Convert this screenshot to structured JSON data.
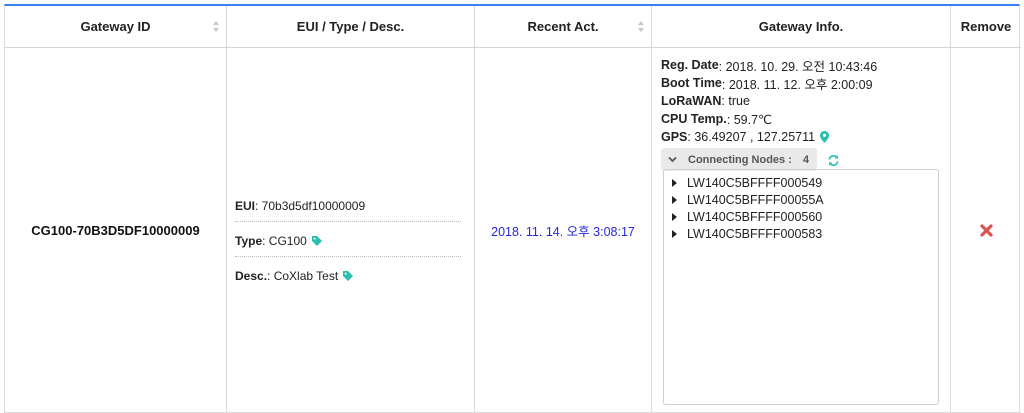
{
  "header": {
    "gateway_id": "Gateway ID",
    "eui_type_desc": "EUI / Type / Desc.",
    "recent_act": "Recent Act.",
    "gateway_info": "Gateway Info.",
    "remove": "Remove"
  },
  "row": {
    "gateway_id": "CG100-70B3D5DF10000009",
    "eui_label": "EUI",
    "eui_value": " : 70b3d5df10000009",
    "type_label": "Type",
    "type_value": " : CG100",
    "desc_label": "Desc.",
    "desc_value": " : CoXlab Test",
    "recent_act": "2018. 11. 14. 오후 3:08:17",
    "info": {
      "reg_date_label": "Reg. Date",
      "reg_date_value": " : 2018. 10. 29. 오전 10:43:46",
      "boot_time_label": "Boot Time",
      "boot_time_value": " : 2018. 11. 12. 오후 2:00:09",
      "lorawan_label": "LoRaWAN",
      "lorawan_value": " : true",
      "cpu_temp_label": "CPU Temp.",
      "cpu_temp_value": " : 59.7℃",
      "gps_label": "GPS",
      "gps_value": " : 36.49207 , 127.25711",
      "connecting_nodes_label": "Connecting Nodes :",
      "connecting_nodes_count": "4",
      "nodes": [
        "LW140C5BFFFF000549",
        "LW140C5BFFFF00055A",
        "LW140C5BFFFF000560",
        "LW140C5BFFFF000583"
      ]
    }
  },
  "icons": {
    "sort": "sort-icon",
    "tag": "tag-icon",
    "map_marker": "map-marker-icon",
    "chevron_down": "chevron-down-icon",
    "refresh": "refresh-icon",
    "caret_right": "caret-right-icon",
    "remove": "remove-icon"
  },
  "colors": {
    "accent_top_border": "#3a7ff0",
    "recent_act_text": "#2626d9",
    "teal_icon": "#2bbfb0",
    "remove_red": "#d9534f",
    "node_bar_bg": "#e9e9e9"
  }
}
